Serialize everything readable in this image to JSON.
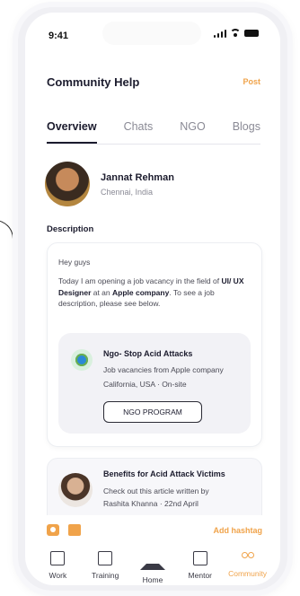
{
  "status_bar": {
    "time": "9:41"
  },
  "header": {
    "title": "Community Help",
    "post_label": "Post"
  },
  "tabs": [
    {
      "label": "Overview",
      "active": true
    },
    {
      "label": "Chats",
      "active": false
    },
    {
      "label": "NGO",
      "active": false
    },
    {
      "label": "Blogs",
      "active": false
    }
  ],
  "profile": {
    "name": "Jannat Rehman",
    "location": "Chennai, India"
  },
  "description": {
    "label": "Description",
    "greeting": "Hey guys",
    "body_pre": "Today I am opening a job vacancy in the field of ",
    "body_role": "UI/ UX Designer",
    "body_mid": " at an ",
    "body_company": "Apple company",
    "body_post": ". To see a job description, please see below."
  },
  "ngo_card": {
    "title": "Ngo- Stop Acid Attacks",
    "subtitle": "Job vacancies from Apple company",
    "location": "California, USA  · On-site",
    "button": "NGO PROGRAM",
    "icon": "globe-hands-icon"
  },
  "article_card": {
    "title": "Benefits for Acid Attack Victims",
    "line1": "Check out this article written by",
    "line2": "Rashita Khanna    · 22nd April"
  },
  "attach_bar": {
    "hashtag_label": "Add hashtag"
  },
  "nav": [
    {
      "label": "Work",
      "icon": "briefcase-icon"
    },
    {
      "label": "Training",
      "icon": "training-icon"
    },
    {
      "label": "Home",
      "icon": "home-icon"
    },
    {
      "label": "Mentor",
      "icon": "mentor-icon"
    },
    {
      "label": "Community",
      "icon": "community-icon",
      "active": true
    }
  ],
  "colors": {
    "accent": "#f0a34a",
    "text": "#1c1c2e",
    "muted": "#8a8a95"
  }
}
